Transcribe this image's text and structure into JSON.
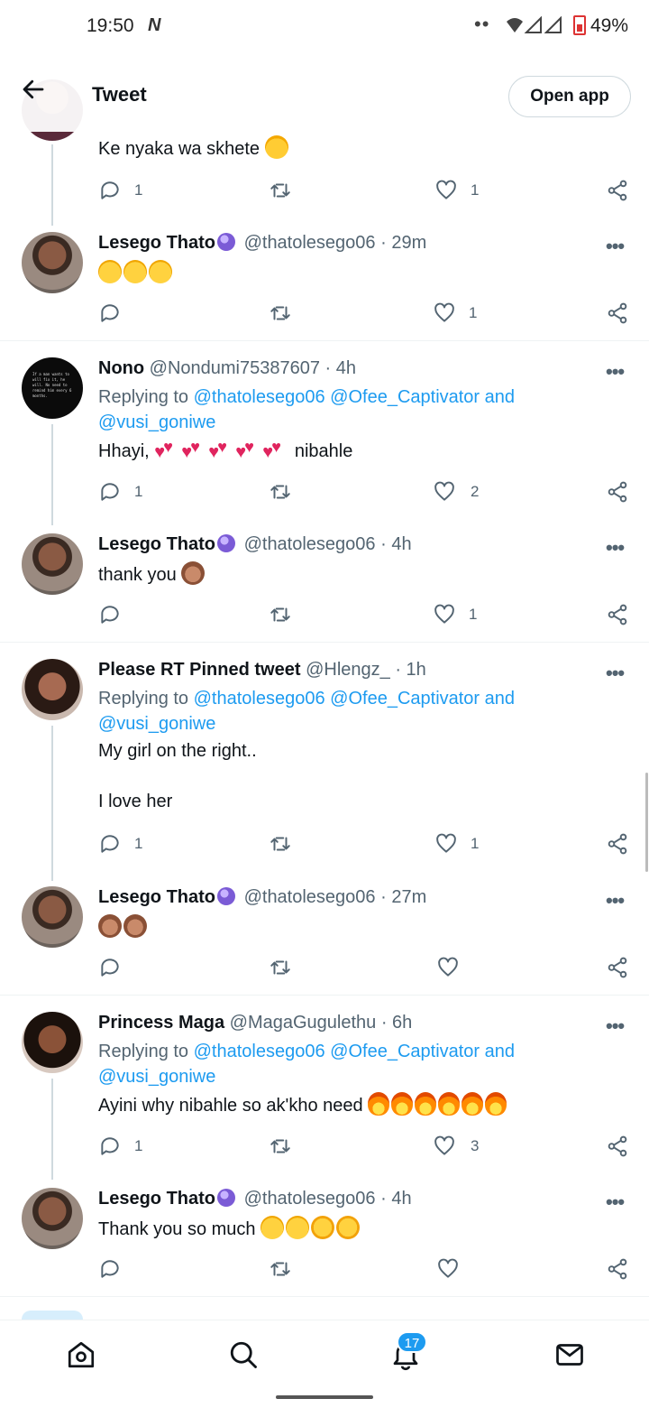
{
  "status_bar": {
    "time": "19:50",
    "carrier_glyph": "N",
    "dots": "••",
    "battery_percent": "49%"
  },
  "header": {
    "title": "Tweet",
    "open_app_label": "Open app"
  },
  "top_partial": {
    "body": "Ke nyaka wa skhete",
    "reply_count": "1",
    "like_count": "1"
  },
  "tweets": [
    {
      "name": "Lesego Thato",
      "handle": "@thatolesego06",
      "time": "· 29m",
      "body": "",
      "reply_count": "",
      "like_count": "1"
    },
    {
      "name": "Nono",
      "handle": "@Nondumi75387607",
      "time": "· 4h",
      "replying_label": "Replying to",
      "mention1": "@thatolesego06",
      "mention2": "@Ofee_Captivator",
      "and_label": "and",
      "mention3": "@vusi_goniwe",
      "body_pre": "Hhayi,",
      "body_post": "nibahle",
      "reply_count": "1",
      "like_count": "2"
    },
    {
      "name": "Lesego Thato",
      "handle": "@thatolesego06",
      "time": "· 4h",
      "body": "thank you",
      "reply_count": "",
      "like_count": "1"
    },
    {
      "name": "Please RT Pinned tweet",
      "handle": "@Hlengz_",
      "time": "· 1h",
      "replying_label": "Replying to",
      "mention1": "@thatolesego06",
      "mention2": "@Ofee_Captivator",
      "and_label": "and",
      "mention3": "@vusi_goniwe",
      "body": "My girl on the right..\n\nI love her",
      "reply_count": "1",
      "like_count": "1"
    },
    {
      "name": "Lesego Thato",
      "handle": "@thatolesego06",
      "time": "· 27m",
      "body": "",
      "reply_count": "",
      "like_count": ""
    },
    {
      "name": "Princess Maga",
      "handle": "@MagaGugulethu",
      "time": "· 6h",
      "replying_label": "Replying to",
      "mention1": "@thatolesego06",
      "mention2": "@Ofee_Captivator",
      "and_label": "and",
      "mention3": "@vusi_goniwe",
      "body": "Ayini why nibahle so ak'kho need",
      "reply_count": "1",
      "like_count": "3"
    },
    {
      "name": "Lesego Thato",
      "handle": "@thatolesego06",
      "time": "· 4h",
      "body": "Thank you so much",
      "reply_count": "",
      "like_count": ""
    }
  ],
  "nono_avatar_text": "If a man wants to will fix it, he will. No need to remind him every 6 months.",
  "bottom_nav": {
    "notifications_badge": "17"
  },
  "icons": {
    "back": "arrow-left-icon",
    "reply": "reply-bubble-icon",
    "retweet": "retweet-icon",
    "like": "heart-icon",
    "share": "share-icon",
    "more": "more-dots-icon",
    "home": "home-icon",
    "search": "search-icon",
    "notifications": "bell-icon",
    "messages": "envelope-icon"
  },
  "colors": {
    "link": "#1d9bf0",
    "text": "#0f1419",
    "secondary": "#536471",
    "badge": "#1d9bf0"
  }
}
